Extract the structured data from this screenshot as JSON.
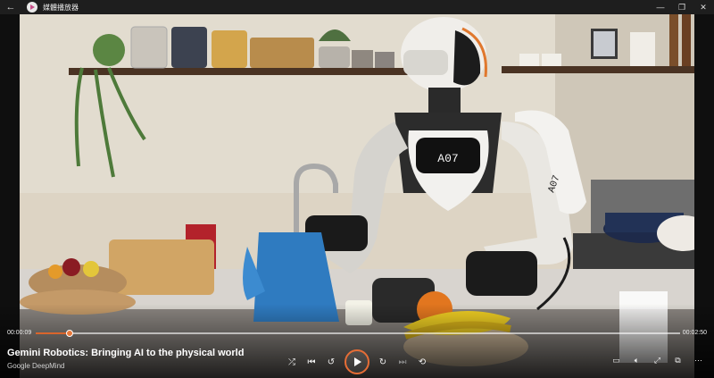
{
  "window": {
    "title": "媒體播放器",
    "back_glyph": "←",
    "minimize_glyph": "—",
    "maximize_glyph": "❐",
    "close_glyph": "✕"
  },
  "video": {
    "title": "Gemini Robotics: Bringing AI to the physical world",
    "channel": "Google DeepMind",
    "robot_label": "A07",
    "robot_arm_label": "A07"
  },
  "playback": {
    "elapsed": "00:00:09",
    "total": "00:02:50",
    "progress_fraction": 0.053
  },
  "controls": {
    "shuffle": "⤮",
    "previous": "⏮",
    "rewind": "↺",
    "forward": "↻",
    "next": "⏭",
    "repeat": "⟲",
    "subtitles": "▭",
    "volume": "🔈︎",
    "fullscreen": "⤢",
    "cast": "⧉",
    "more": "⋯"
  },
  "colors": {
    "accent": "#e56d36"
  }
}
